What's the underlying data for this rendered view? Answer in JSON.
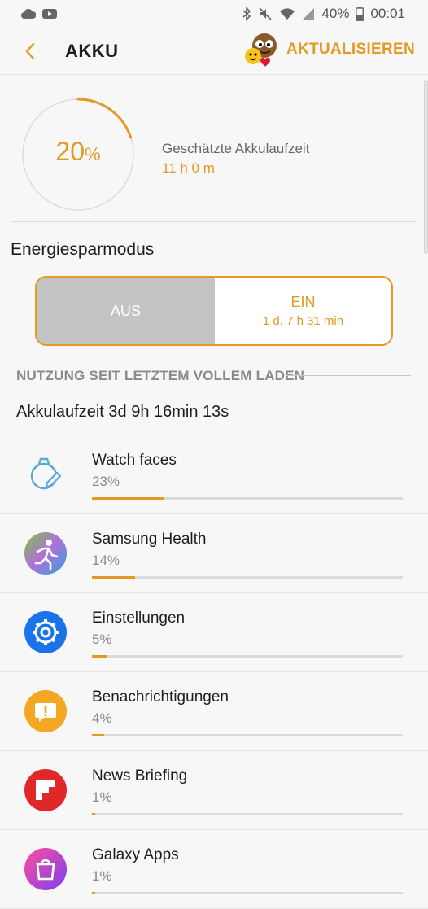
{
  "status_bar": {
    "battery_percent": "40%",
    "time": "00:01"
  },
  "header": {
    "title": "AKKU",
    "update_label": "AKTUALISIEREN"
  },
  "battery": {
    "level": 20,
    "percent_number": "20",
    "percent_unit": "%",
    "estimate_label": "Geschätzte Akkulaufzeit",
    "estimate_value": "11 h 0 m"
  },
  "power_saving": {
    "label": "Energiesparmodus",
    "off_label": "AUS",
    "on_label": "EIN",
    "on_duration": "1 d, 7 h 31 min",
    "selected": "AUS"
  },
  "usage": {
    "section_title": "NUTZUNG SEIT LETZTEM VOLLEM LADEN",
    "runtime": "Akkulaufzeit 3d 9h 16min 13s",
    "apps": [
      {
        "name": "Watch faces",
        "percent_text": "23%",
        "percent": 23,
        "icon": "watch-face-icon"
      },
      {
        "name": "Samsung Health",
        "percent_text": "14%",
        "percent": 14,
        "icon": "samsung-health-icon"
      },
      {
        "name": "Einstellungen",
        "percent_text": "5%",
        "percent": 5,
        "icon": "settings-gear-icon"
      },
      {
        "name": "Benachrichtigungen",
        "percent_text": "4%",
        "percent": 4,
        "icon": "notification-icon"
      },
      {
        "name": "News Briefing",
        "percent_text": "1%",
        "percent": 1,
        "icon": "flipboard-icon"
      },
      {
        "name": "Galaxy Apps",
        "percent_text": "1%",
        "percent": 1,
        "icon": "galaxy-apps-icon"
      }
    ]
  },
  "colors": {
    "accent": "#e39a24",
    "toggle_off": "#c4c4c4"
  }
}
